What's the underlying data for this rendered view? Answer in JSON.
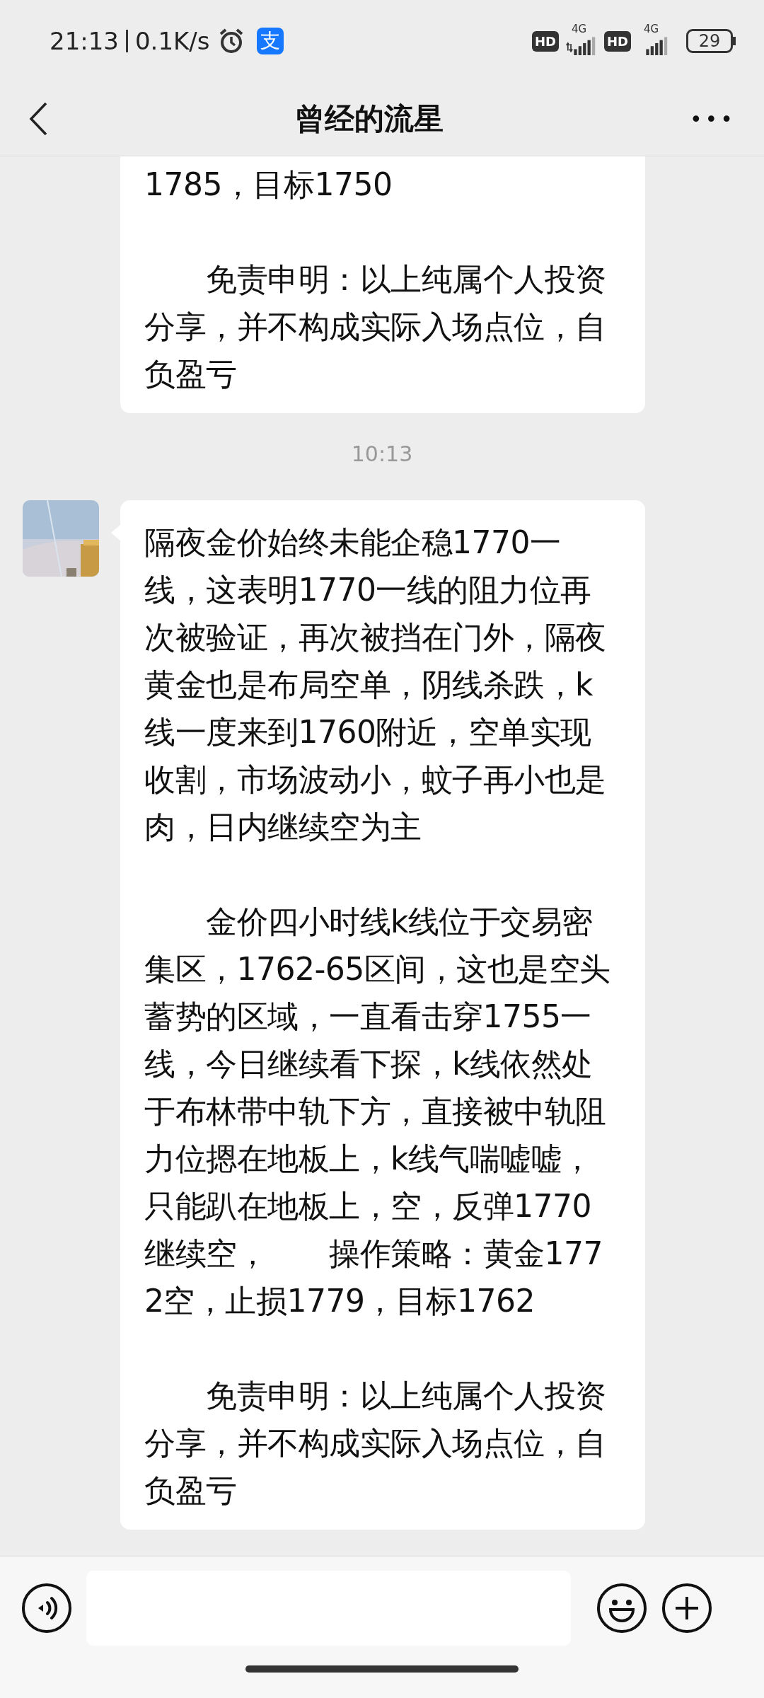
{
  "status_bar": {
    "time": "21:13",
    "speed": "0.1K/s",
    "app_badge": "支",
    "sims": [
      {
        "hd": "HD",
        "network": "4G",
        "kind": "data"
      },
      {
        "hd": "HD",
        "network": "4G",
        "kind": "plain"
      }
    ],
    "battery": "29"
  },
  "nav": {
    "title": "曾经的流星",
    "more": "•••"
  },
  "messages": [
    {
      "kind": "bubble",
      "avatar": false,
      "paragraphs": [
        "1785，目标1750",
        "　　免责申明：以上纯属个人投资分享，并不构成实际入场点位，自负盈亏"
      ]
    },
    {
      "kind": "time",
      "text": "10:13"
    },
    {
      "kind": "bubble",
      "avatar": true,
      "paragraphs": [
        "隔夜金价始终未能企稳1770一线，这表明1770一线的阻力位再次被验证，再次被挡在门外，隔夜黄金也是布局空单，阴线杀跌，k线一度来到1760附近，空单实现收割，市场波动小，蚊子再小也是肉，日内继续空为主",
        "　　金价四小时线k线位于交易密集区，1762-65区间，这也是空头蓄势的区域，一直看击穿1755一线，今日继续看下探，k线依然处于布林带中轨下方，直接被中轨阻力位摁在地板上，k线气喘嘘嘘，只能趴在地板上，空，反弹1770继续空，　　操作策略：黄金1772空，止损1779，目标1762",
        "　　免责申明：以上纯属个人投资分享，并不构成实际入场点位，自负盈亏"
      ]
    }
  ]
}
